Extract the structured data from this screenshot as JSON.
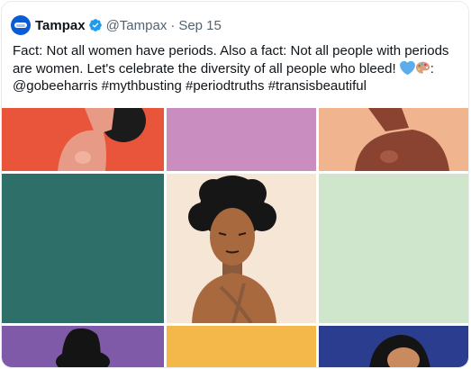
{
  "tweet": {
    "author_name": "Tampax",
    "handle": "@Tampax",
    "separator": "·",
    "date": "Sep 15",
    "text_lines": [
      "Fact: Not all women have periods. Also a fact: Not all people with periods",
      "are women. Let's celebrate the diversity of all people who bleed!",
      "@gobeeharris #mythbusting #periodtruths #transisbeautiful"
    ],
    "text_line2_suffix": ":"
  },
  "icons": {
    "avatar": "tampax-logo-avatar",
    "verified": "verified-badge-icon",
    "emojis": [
      "blue-heart-emoji",
      "artist-palette-emoji"
    ]
  },
  "media": {
    "description_tiles": [
      {
        "color": "#e8553a",
        "content": "figure"
      },
      {
        "color": "#c98dbf",
        "content": "empty"
      },
      {
        "color": "#f0b48e",
        "content": "figure"
      },
      {
        "color": "#2f6f6a",
        "content": "empty"
      },
      {
        "color": "#f6e6d6",
        "content": "figure"
      },
      {
        "color": "#cfe6cd",
        "content": "empty"
      },
      {
        "color": "#7f5aa8",
        "content": "figure"
      },
      {
        "color": "#f4b84a",
        "content": "empty"
      },
      {
        "color": "#2b3d8f",
        "content": "figure"
      }
    ]
  },
  "colors": {
    "text_primary": "#0f1419",
    "text_secondary": "#536471",
    "verified_blue": "#1d9bf0",
    "border": "#e6ecf0"
  }
}
